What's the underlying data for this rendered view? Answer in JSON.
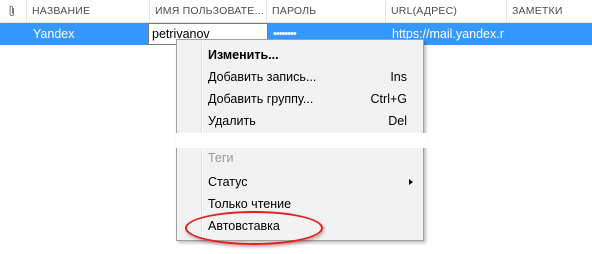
{
  "table": {
    "columns": [
      "НАЗВАНИЕ",
      "ИМЯ ПОЛЬЗОВАТЕ...",
      "ПАРОЛЬ",
      "URL(АДРЕС)",
      "ЗАМЕТКИ"
    ],
    "attach_icon": "paperclip-icon",
    "selected_row": {
      "title": "Yandex",
      "username": "petrivanov",
      "password": "••••••••",
      "url": "https://mail.yandex.r",
      "notes": ""
    },
    "selection_color": "#3399ff"
  },
  "context_menu": {
    "items": [
      {
        "label": "Изменить...",
        "shortcut": "",
        "bold": true
      },
      {
        "label": "Добавить запись...",
        "shortcut": "Ins"
      },
      {
        "label": "Добавить группу...",
        "shortcut": "Ctrl+G"
      },
      {
        "label": "Удалить",
        "shortcut": "Del"
      },
      {
        "label": "Теги",
        "shortcut": "",
        "disabled": true
      },
      {
        "label": "Статус",
        "shortcut": "",
        "submenu": true
      },
      {
        "label": "Только чтение",
        "shortcut": ""
      },
      {
        "label": "Автовставка",
        "shortcut": "",
        "highlighted": true
      }
    ],
    "highlight_color": "#e02020"
  }
}
